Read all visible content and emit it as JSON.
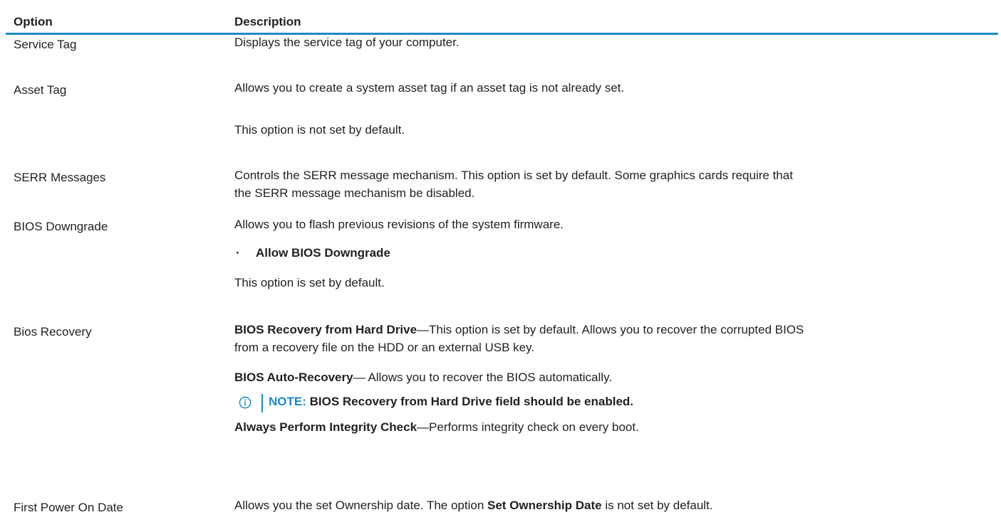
{
  "table": {
    "headers": {
      "option": "Option",
      "description": "Description"
    },
    "rows": [
      {
        "option": "Service Tag",
        "p1": "Displays the service tag of your computer."
      },
      {
        "option": "Asset Tag",
        "p1": "Allows you to create a system asset tag if an asset tag is not already set.",
        "p2": "This option is not set by default."
      },
      {
        "option": "SERR Messages",
        "p1_line1": "Controls the SERR message mechanism. This option is set by default. Some graphics cards require that",
        "p1_line2": "the SERR message mechanism be disabled."
      },
      {
        "option": "BIOS Downgrade",
        "p1": "Allows you to flash previous revisions of the system firmware.",
        "bullet_marker": "·",
        "bullet": "Allow BIOS Downgrade",
        "p2": "This option is set by default."
      },
      {
        "option": "Bios Recovery",
        "p1_bold": "BIOS Recovery from Hard Drive",
        "p1_line1_rest": "—This option is set by default. Allows you to recover the corrupted BIOS",
        "p1_line2": "from a recovery file on the HDD or an external USB key.",
        "p2_bold": "BIOS Auto-Recovery",
        "p2_rest": "— Allows you to recover the BIOS automatically.",
        "note_label": "NOTE:",
        "note_text": " BIOS Recovery from Hard Drive field should be enabled.",
        "p3_bold": "Always Perform Integrity Check",
        "p3_rest": "—Performs integrity check on every boot."
      },
      {
        "option": "First Power On Date",
        "p1_start": "Allows you the set Ownership date. The option ",
        "p1_bold": "Set Ownership Date",
        "p1_end": " is not set by default."
      }
    ]
  },
  "colors": {
    "accent": "#1a8bc8",
    "text": "#231f20"
  },
  "icons": {
    "note": "info-circle-icon"
  }
}
